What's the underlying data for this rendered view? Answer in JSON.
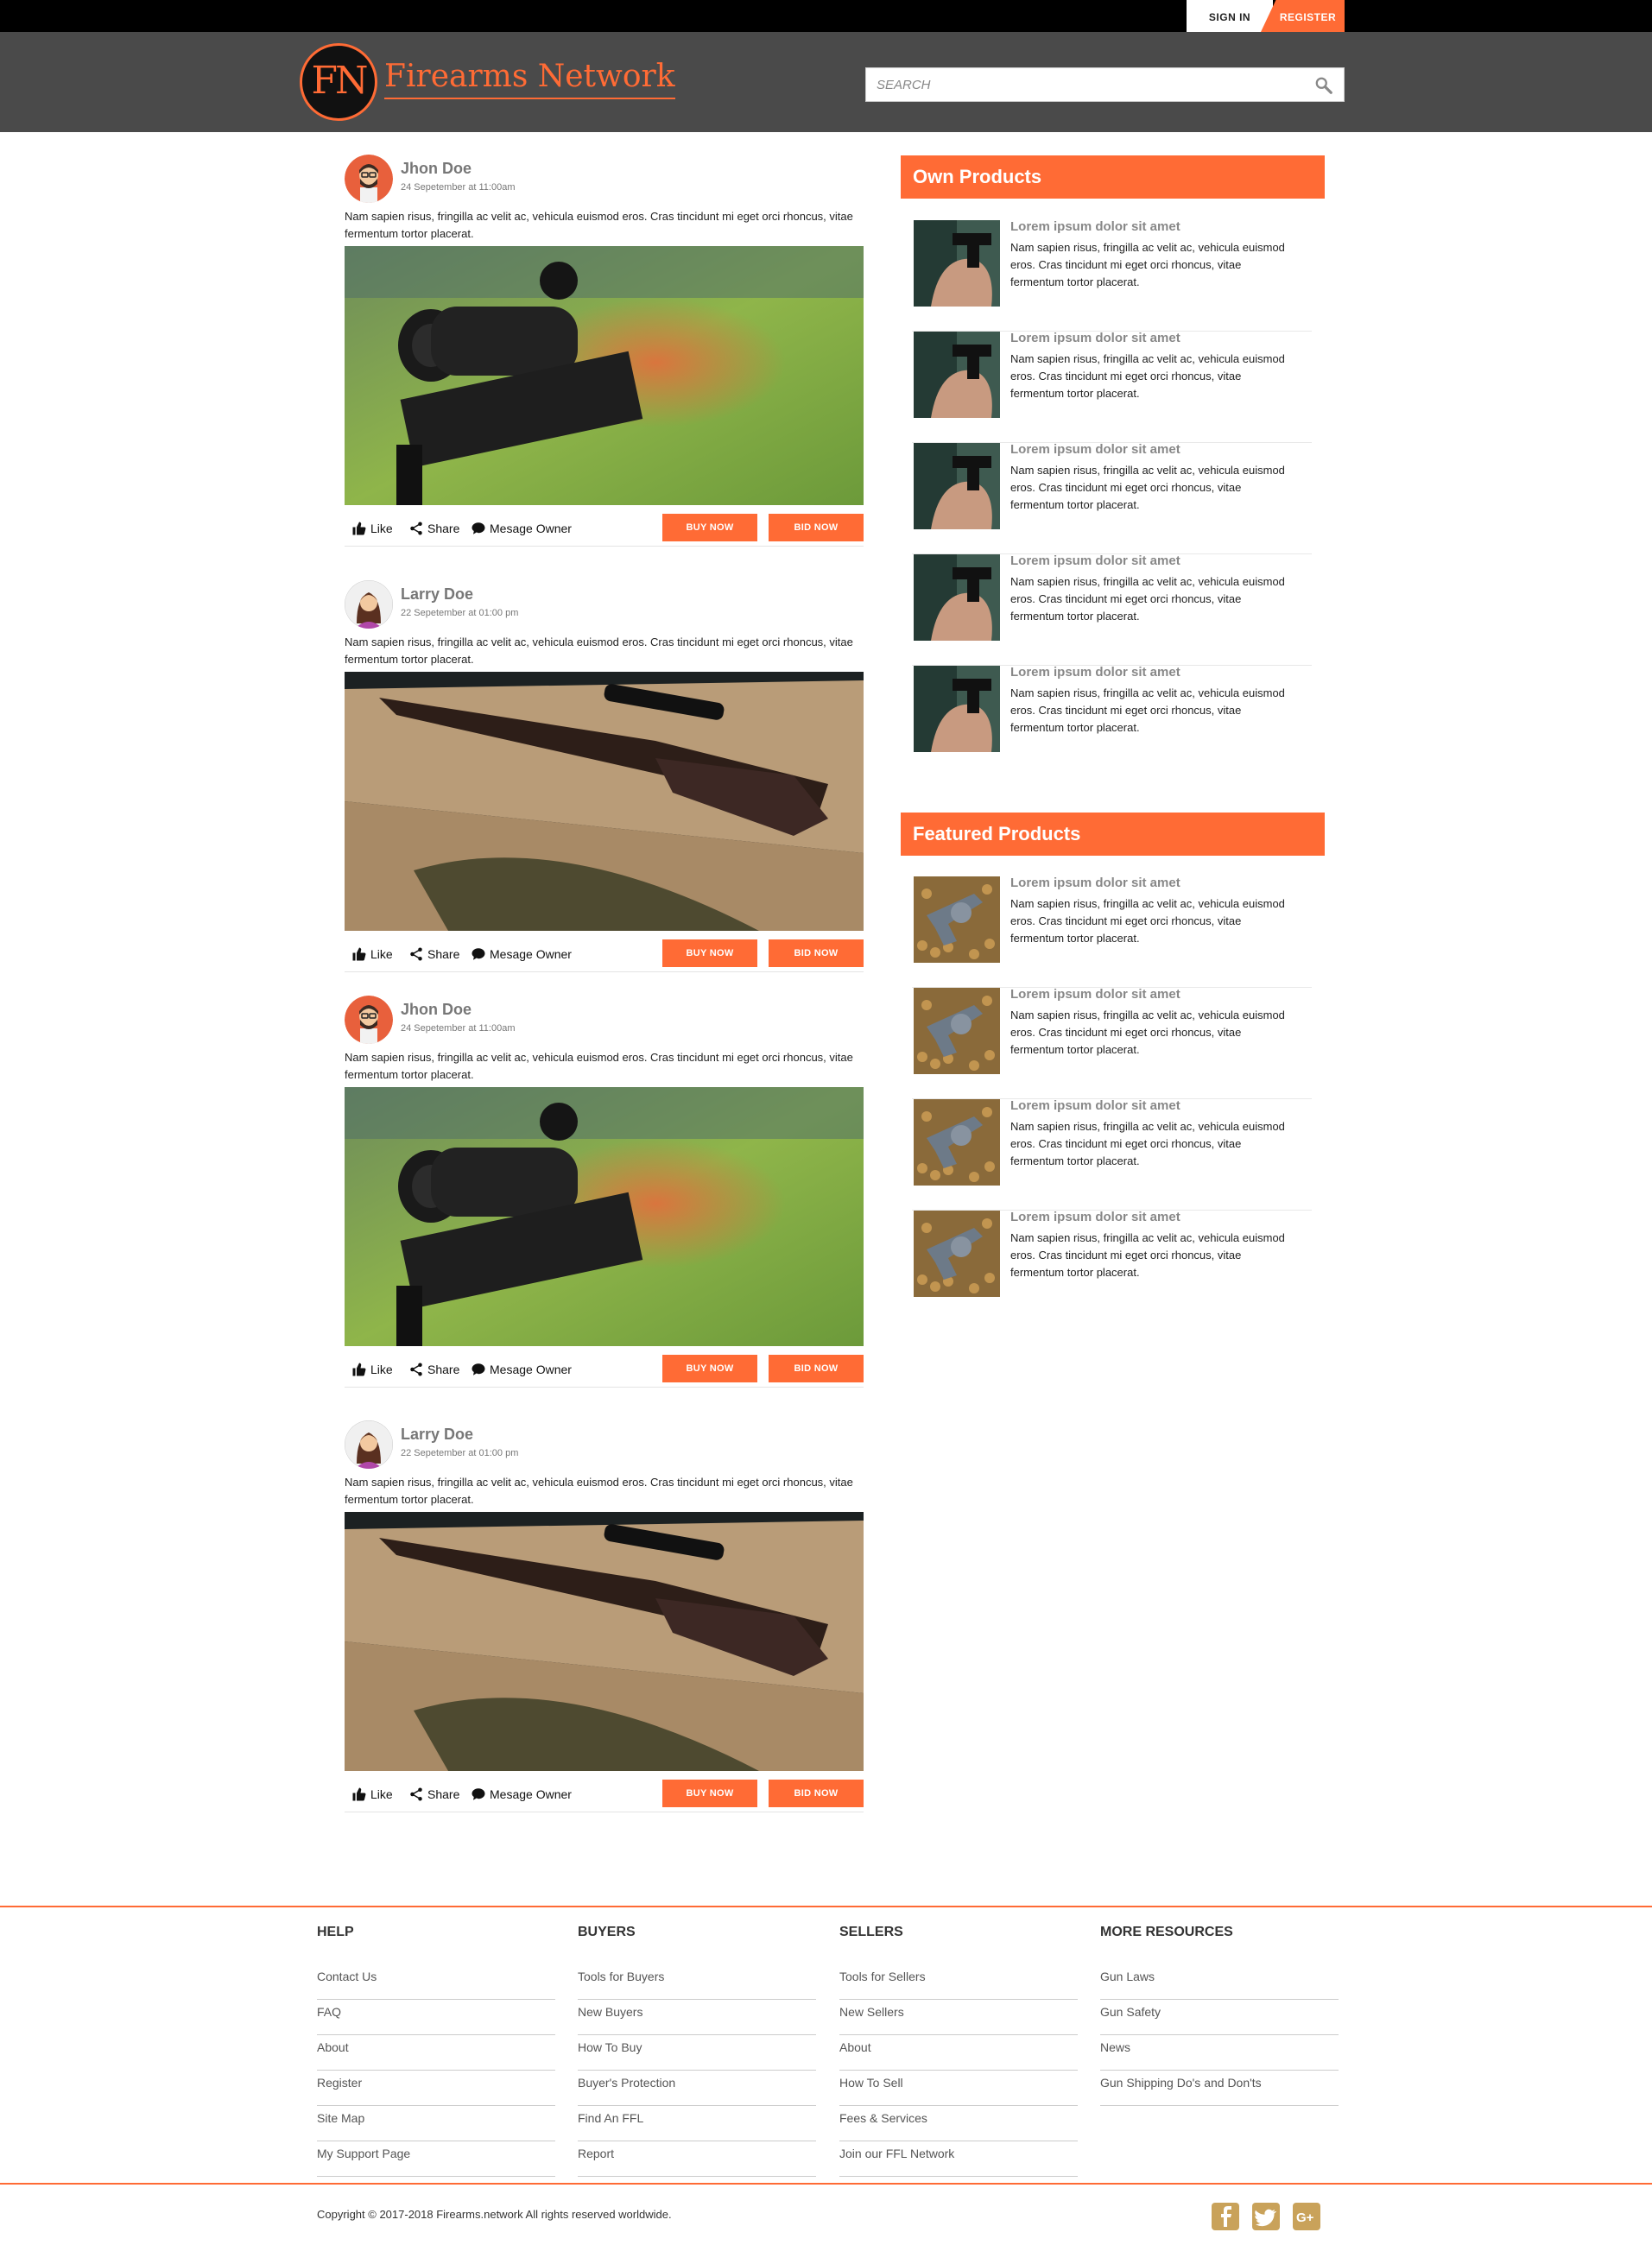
{
  "topbar": {
    "signin_label": "SIGN IN",
    "register_label": "REGISTER"
  },
  "header": {
    "logo_mark": "FN",
    "site_name": "Firearms Network",
    "search_placeholder": "SEARCH"
  },
  "posts": [
    {
      "author": "Jhon Doe",
      "date": "24 Sepetember at 11:00am",
      "text": "Nam sapien risus, fringilla ac velit ac, vehicula euismod eros. Cras tincidunt mi eget orci rhoncus, vitae fermentum tortor placerat.",
      "like": "Like",
      "share": "Share",
      "message": "Mesage Owner",
      "buy": "BUY NOW",
      "bid": "BID NOW"
    },
    {
      "author": "Larry Doe",
      "date": "22 Sepetember at 01:00 pm",
      "text": "Nam sapien risus, fringilla ac velit ac, vehicula euismod eros. Cras tincidunt mi eget orci rhoncus, vitae fermentum tortor placerat.",
      "like": "Like",
      "share": "Share",
      "message": "Mesage Owner",
      "buy": "BUY NOW",
      "bid": "BID NOW"
    },
    {
      "author": "Jhon Doe",
      "date": "24 Sepetember at 11:00am",
      "text": "Nam sapien risus, fringilla ac velit ac, vehicula euismod eros. Cras tincidunt mi eget orci rhoncus, vitae fermentum tortor placerat.",
      "like": "Like",
      "share": "Share",
      "message": "Mesage Owner",
      "buy": "BUY NOW",
      "bid": "BID NOW"
    },
    {
      "author": "Larry Doe",
      "date": "22 Sepetember at 01:00 pm",
      "text": "Nam sapien risus, fringilla ac velit ac, vehicula euismod eros. Cras tincidunt mi eget orci rhoncus, vitae fermentum tortor placerat.",
      "like": "Like",
      "share": "Share",
      "message": "Mesage Owner",
      "buy": "BUY NOW",
      "bid": "BID NOW"
    }
  ],
  "own_products": {
    "title": "Own Products",
    "items": [
      {
        "title": "Lorem ipsum dolor sit amet",
        "desc": "Nam sapien risus, fringilla ac velit ac, vehicula euismod eros. Cras tincidunt mi eget orci rhoncus, vitae fermentum tortor placerat."
      },
      {
        "title": "Lorem ipsum dolor sit amet",
        "desc": "Nam sapien risus, fringilla ac velit ac, vehicula euismod eros. Cras tincidunt mi eget orci rhoncus, vitae fermentum tortor placerat."
      },
      {
        "title": "Lorem ipsum dolor sit amet",
        "desc": "Nam sapien risus, fringilla ac velit ac, vehicula euismod eros. Cras tincidunt mi eget orci rhoncus, vitae fermentum tortor placerat."
      },
      {
        "title": "Lorem ipsum dolor sit amet",
        "desc": "Nam sapien risus, fringilla ac velit ac, vehicula euismod eros. Cras tincidunt mi eget orci rhoncus, vitae fermentum tortor placerat."
      },
      {
        "title": "Lorem ipsum dolor sit amet",
        "desc": "Nam sapien risus, fringilla ac velit ac, vehicula euismod eros. Cras tincidunt mi eget orci rhoncus, vitae fermentum tortor placerat."
      }
    ]
  },
  "featured_products": {
    "title": "Featured Products",
    "items": [
      {
        "title": "Lorem ipsum dolor sit amet",
        "desc": "Nam sapien risus, fringilla ac velit ac, vehicula euismod eros. Cras tincidunt mi eget orci rhoncus, vitae fermentum tortor placerat."
      },
      {
        "title": "Lorem ipsum dolor sit amet",
        "desc": "Nam sapien risus, fringilla ac velit ac, vehicula euismod eros. Cras tincidunt mi eget orci rhoncus, vitae fermentum tortor placerat."
      },
      {
        "title": "Lorem ipsum dolor sit amet",
        "desc": "Nam sapien risus, fringilla ac velit ac, vehicula euismod eros. Cras tincidunt mi eget orci rhoncus, vitae fermentum tortor placerat."
      },
      {
        "title": "Lorem ipsum dolor sit amet",
        "desc": "Nam sapien risus, fringilla ac velit ac, vehicula euismod eros. Cras tincidunt mi eget orci rhoncus, vitae fermentum tortor placerat."
      }
    ]
  },
  "footer": {
    "columns": [
      {
        "title": "HELP",
        "links": [
          "Contact Us",
          "FAQ",
          "About",
          "Register",
          "Site Map",
          "My Support Page"
        ]
      },
      {
        "title": "BUYERS",
        "links": [
          "Tools for Buyers",
          "New Buyers",
          "How To Buy",
          "Buyer's Protection",
          "Find An FFL",
          "Report"
        ]
      },
      {
        "title": "SELLERS",
        "links": [
          "Tools for Sellers",
          "New Sellers",
          "About",
          "How To Sell",
          "Fees & Services",
          "Join our FFL Network"
        ]
      },
      {
        "title": "MORE RESOURCES",
        "links": [
          "Gun Laws",
          "Gun Safety",
          "News",
          "Gun Shipping Do's and Don'ts"
        ]
      }
    ],
    "copyright": "Copyright © 2017-2018 Firearms.network All rights reserved worldwide.",
    "social": [
      "facebook-icon",
      "twitter-icon",
      "google-plus-icon"
    ]
  },
  "colors": {
    "accent": "#ff6b35",
    "header_bg": "#4a4a4a",
    "topbar_bg": "#000000",
    "social_gold": "#c9a25a"
  }
}
